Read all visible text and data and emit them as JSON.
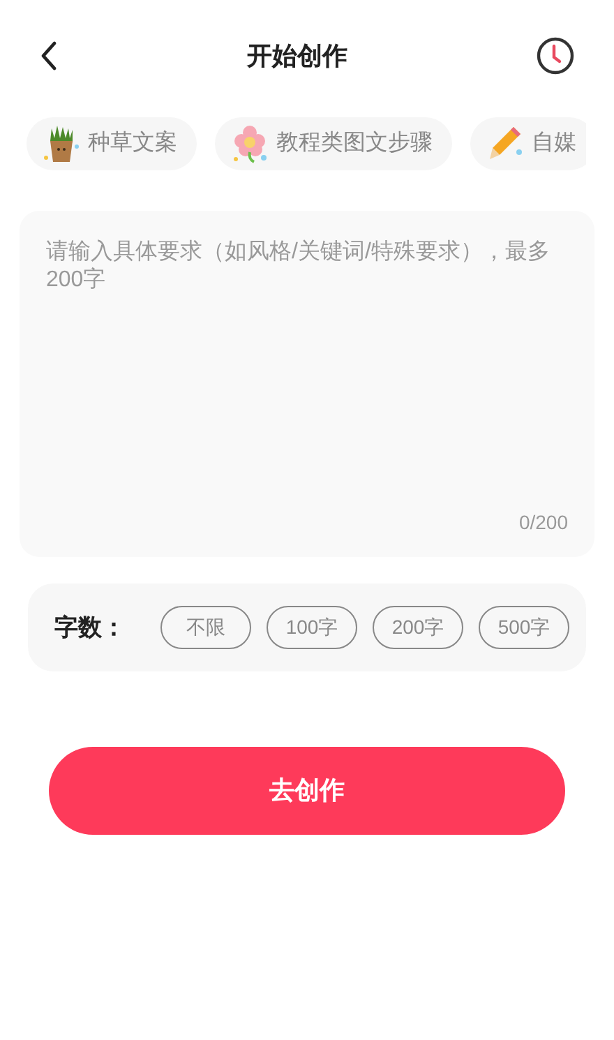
{
  "header": {
    "title": "开始创作"
  },
  "templates": [
    {
      "label": "种草文案",
      "kind": "plant"
    },
    {
      "label": "教程类图文步骤",
      "kind": "flower"
    },
    {
      "label": "自媒",
      "kind": "pencil"
    }
  ],
  "prompt": {
    "placeholder": "请输入具体要求（如风格/关键词/特殊要求），最多200字",
    "counter": "0/200"
  },
  "word_count": {
    "label": "字数：",
    "options": [
      {
        "label": "不限",
        "selected": false
      },
      {
        "label": "100字",
        "selected": false
      },
      {
        "label": "200字",
        "selected": false
      },
      {
        "label": "500字",
        "selected": false
      }
    ]
  },
  "submit": "去创作"
}
